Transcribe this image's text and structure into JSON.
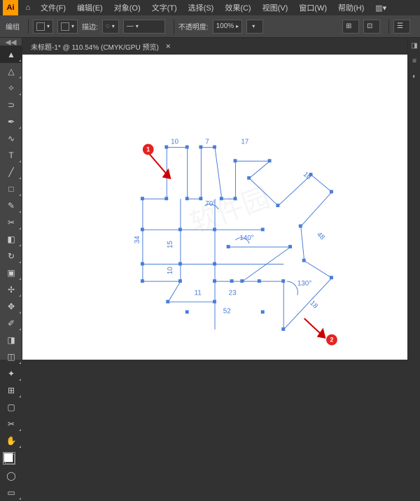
{
  "app": {
    "logo": "Ai"
  },
  "menu": {
    "file": "文件(F)",
    "edit": "编辑(E)",
    "object": "对象(O)",
    "text": "文字(T)",
    "select": "选择(S)",
    "effect": "效果(C)",
    "view": "视图(V)",
    "window": "窗口(W)",
    "help": "帮助(H)"
  },
  "options": {
    "group_label": "编组",
    "stroke_label": "描边:",
    "opacity_label": "不透明度:",
    "opacity_value": "100%"
  },
  "tab": {
    "title": "未标题-1* @ 110.54% (CMYK/GPU 预览)",
    "close": "×"
  },
  "badges": {
    "one": "1",
    "two": "2"
  },
  "dims": {
    "d10a": "10",
    "d7": "7",
    "d17": "17",
    "d10b": "10",
    "a70": "70°",
    "a140": "140°",
    "d34": "34",
    "d15": "15",
    "d10c": "10",
    "d48": "48",
    "a130": "130°",
    "d11": "11",
    "d23": "23",
    "d18": "18",
    "d52": "52"
  }
}
